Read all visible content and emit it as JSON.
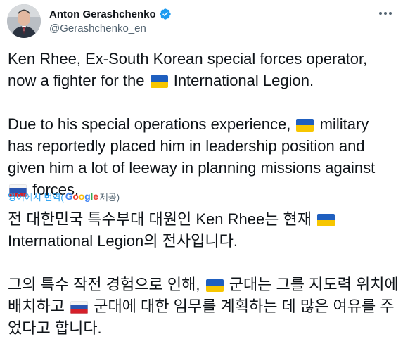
{
  "author": {
    "display_name": "Anton Gerashchenko",
    "handle": "@Gerashchenko_en",
    "verified": true
  },
  "tweet": {
    "para1_a": "Ken Rhee, Ex-South Korean special forces operator, now a fighter for the",
    "para1_b": "International Legion.",
    "para2_a": "Due to his special operations experience,",
    "para2_b": "military has reportedly placed him in leadership position and given him a lot of leeway in planning missions against",
    "para2_c": "forces."
  },
  "translation": {
    "label": "영어에서 번역(",
    "provider": "Google",
    "provided_suffix": " 제공)",
    "para1_a": "전 대한민국 특수부대 대원인 Ken Rhee는 현재",
    "para1_b": "International Legion의 전사입니다.",
    "para2_a": " 그의 특수 작전 경험으로 인해,",
    "para2_b": "군대는 그를 지도력 위치에 배치하고",
    "para2_c": "군대에 대한 임무를 계획하는 데 많은 여유를 주었다고 합니다."
  },
  "icons": {
    "verified": "verified-badge-icon",
    "more": "more-options-icon",
    "flag_ukraine": "ukraine-flag-icon",
    "flag_russia": "russia-flag-icon"
  },
  "colors": {
    "text": "#0f1419",
    "secondary": "#536471",
    "link": "#1d9bf0",
    "ukraine_blue": "#1f5fbf",
    "ukraine_yellow": "#f7c600",
    "russia_white": "#f5f5f5",
    "russia_blue": "#2a55b0",
    "russia_red": "#d5202a"
  }
}
